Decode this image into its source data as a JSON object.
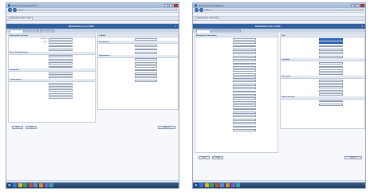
{
  "screenshots": [
    {
      "window_title": "Windows Internet Explorer",
      "address": "http://",
      "page_title": "Alimentacion de la Vida",
      "help": "?",
      "subtabs": [
        {
          "label": ""
        },
        {
          "label": ""
        },
        {
          "label": ""
        }
      ],
      "left": {
        "sections": [
          {
            "title": "Informacion General",
            "rows": [
              "Personas",
              "Edad",
              "",
              ""
            ]
          },
          {
            "title": "Nivel de Satisfaccion",
            "rows": [
              "",
              "",
              "",
              ""
            ]
          },
          {
            "title": "Evaluacion",
            "rows": [
              "",
              ""
            ]
          },
          {
            "title": "Comentarios",
            "rows": [
              "",
              "",
              "",
              "",
              ""
            ]
          }
        ]
      },
      "right": {
        "sections": [
          {
            "title": "Calidad",
            "rows": [
              ""
            ]
          },
          {
            "title": "Frecuencia",
            "rows": [
              "",
              "",
              ""
            ]
          },
          {
            "title": "Distribucion",
            "rows": [
              "",
              "",
              "",
              "",
              "",
              "",
              ""
            ]
          }
        ]
      },
      "buttons": {
        "back": "Atras",
        "clear": "Limpiar",
        "next": "Siguiente"
      }
    },
    {
      "window_title": "Windows Internet Explorer",
      "address": "http://",
      "page_title": "Alimentacion de la Vida",
      "help": "?",
      "subtabs": [
        {
          "label": ""
        },
        {
          "label": ""
        },
        {
          "label": ""
        }
      ],
      "left": {
        "sections": [
          {
            "title": "Alimentos Consumidos",
            "rows": [
              "",
              "",
              "",
              "",
              "",
              "",
              "",
              "",
              "",
              "",
              "",
              "",
              "",
              "",
              "",
              "",
              "",
              "",
              "",
              "",
              "",
              "",
              "",
              "",
              "",
              "",
              ""
            ]
          }
        ]
      },
      "right": {
        "sections": [
          {
            "title": "Tipo",
            "rows": [
              "",
              "",
              "",
              "",
              "",
              ""
            ]
          },
          {
            "title": "Cantidad",
            "rows": [
              "",
              "",
              "",
              ""
            ]
          },
          {
            "title": "Porciones",
            "rows": [
              "",
              "",
              "",
              "",
              ""
            ]
          },
          {
            "title": "Observaciones",
            "rows": [
              "",
              ""
            ]
          }
        ]
      },
      "buttons": {
        "back": "Atras",
        "clear": "Limpiar",
        "next": "Siguiente"
      }
    }
  ],
  "taskbar_icon_colors": [
    "#2e7cd6",
    "#f0b429",
    "#3aa356",
    "#c44b3a",
    "#5b8fd9",
    "#e08a2b",
    "#7c5cc4",
    "#2fa7b3"
  ],
  "accent_color": "#2f5f9e"
}
